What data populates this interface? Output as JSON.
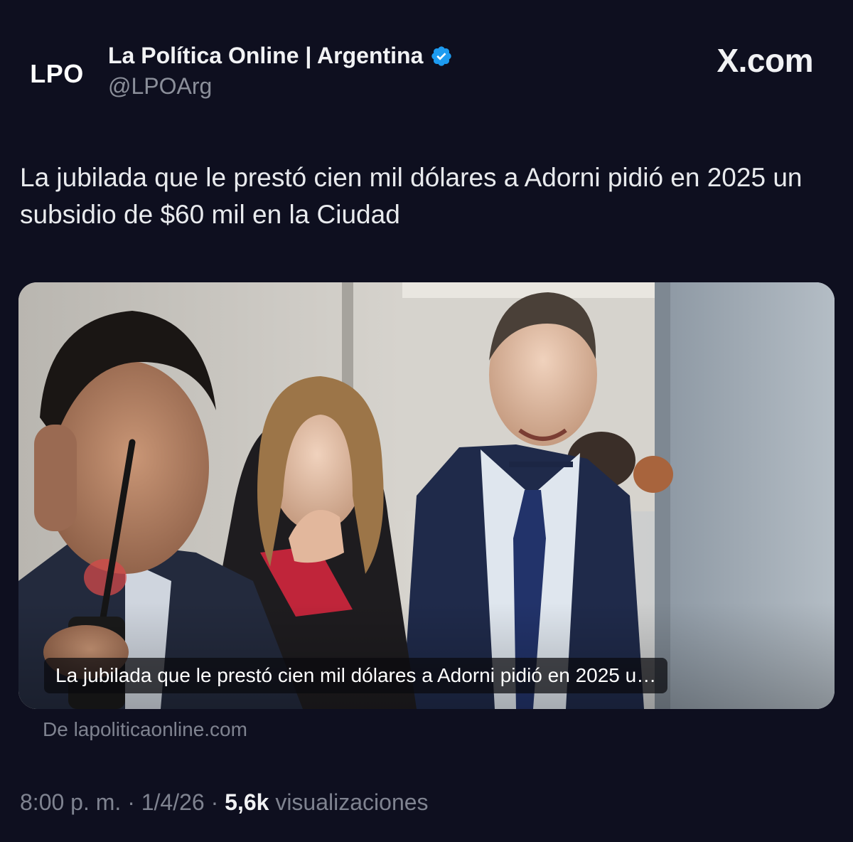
{
  "author": {
    "avatar_text": "LPO",
    "name": "La Política Online | Argentina",
    "handle": "@LPOArg",
    "verified_color": "#1d9bf0"
  },
  "brand": "X.com",
  "tweet": {
    "text": "La jubilada que le prestó cien mil dólares a Adorni pidió en 2025 un subsidio de $60 mil en la Ciudad"
  },
  "card": {
    "caption": "La jubilada que le prestó cien mil dólares a Adorni pidió en 2025 u…",
    "source_prefix": "De",
    "source_domain": "lapoliticaonline.com"
  },
  "meta": {
    "time": "8:00 p. m.",
    "sep1": "·",
    "date": "1/4/26",
    "sep2": "·",
    "views_count": "5,6k",
    "views_label": "visualizaciones"
  },
  "colors": {
    "background": "#0e0f1f",
    "text_primary": "#e8eaed",
    "text_secondary": "#7f8390"
  }
}
